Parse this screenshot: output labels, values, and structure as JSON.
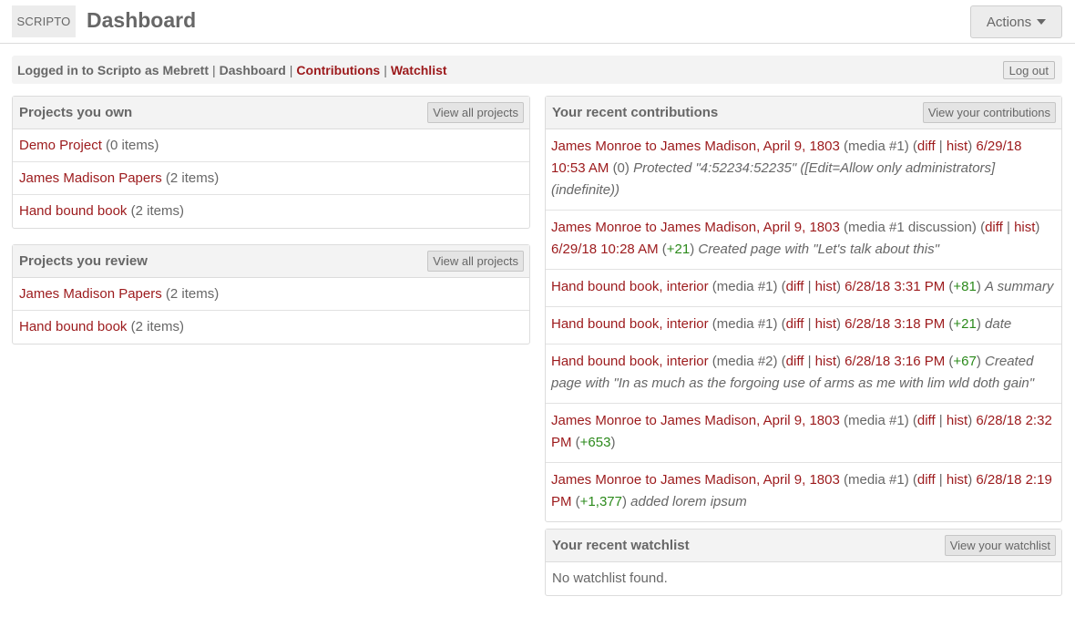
{
  "header": {
    "brand": "SCRIPTO",
    "title": "Dashboard",
    "actions_label": "Actions"
  },
  "userbar": {
    "logged_in_text": "Logged in to Scripto as Mebrett",
    "dashboard_label": "Dashboard",
    "contributions_label": "Contributions",
    "watchlist_label": "Watchlist",
    "separator": "|",
    "logout_label": "Log out"
  },
  "projects_own": {
    "title": "Projects you own",
    "button_label": "View all projects",
    "items": [
      {
        "name": "Demo Project",
        "count": "(0 items)"
      },
      {
        "name": "James Madison Papers",
        "count": "(2 items)"
      },
      {
        "name": "Hand bound book",
        "count": "(2 items)"
      }
    ]
  },
  "projects_review": {
    "title": "Projects you review",
    "button_label": "View all projects",
    "items": [
      {
        "name": "James Madison Papers",
        "count": "(2 items)"
      },
      {
        "name": "Hand bound book",
        "count": "(2 items)"
      }
    ]
  },
  "contributions": {
    "title": "Your recent contributions",
    "button_label": "View your contributions",
    "diff_label": "diff",
    "hist_label": "hist",
    "items": [
      {
        "page": "James Monroe to James Madison, April 9, 1803",
        "media": "(media #1)",
        "timestamp": "6/29/18 10:53 AM",
        "size": "(0)",
        "size_change": "",
        "summary": "Protected \"4:52234:52235\" ([Edit=Allow only administrators] (indefinite))"
      },
      {
        "page": "James Monroe to James Madison, April 9, 1803",
        "media": "(media #1 discussion)",
        "timestamp": "6/29/18 10:28 AM",
        "size": "",
        "size_change": "+21",
        "summary": "Created page with \"Let's talk about this\""
      },
      {
        "page": "Hand bound book, interior",
        "media": "(media #1)",
        "timestamp": "6/28/18 3:31 PM",
        "size": "",
        "size_change": "+81",
        "summary": "A summary"
      },
      {
        "page": "Hand bound book, interior",
        "media": "(media #1)",
        "timestamp": "6/28/18 3:18 PM",
        "size": "",
        "size_change": "+21",
        "summary": "date"
      },
      {
        "page": "Hand bound book, interior",
        "media": "(media #2)",
        "timestamp": "6/28/18 3:16 PM",
        "size": "",
        "size_change": "+67",
        "summary": "Created page with \"In as much as the forgoing use of arms as me with lim wld doth gain\""
      },
      {
        "page": "James Monroe to James Madison, April 9, 1803",
        "media": "(media #1)",
        "timestamp": "6/28/18 2:32 PM",
        "size": "",
        "size_change": "+653",
        "summary": ""
      },
      {
        "page": "James Monroe to James Madison, April 9, 1803",
        "media": "(media #1)",
        "timestamp": "6/28/18 2:19 PM",
        "size": "",
        "size_change": "+1,377",
        "summary": "added lorem ipsum"
      }
    ]
  },
  "watchlist": {
    "title": "Your recent watchlist",
    "button_label": "View your watchlist",
    "empty_text": "No watchlist found."
  },
  "colors": {
    "link": "#9c1a1c",
    "positive": "#2c8a1c",
    "text": "#676767"
  }
}
